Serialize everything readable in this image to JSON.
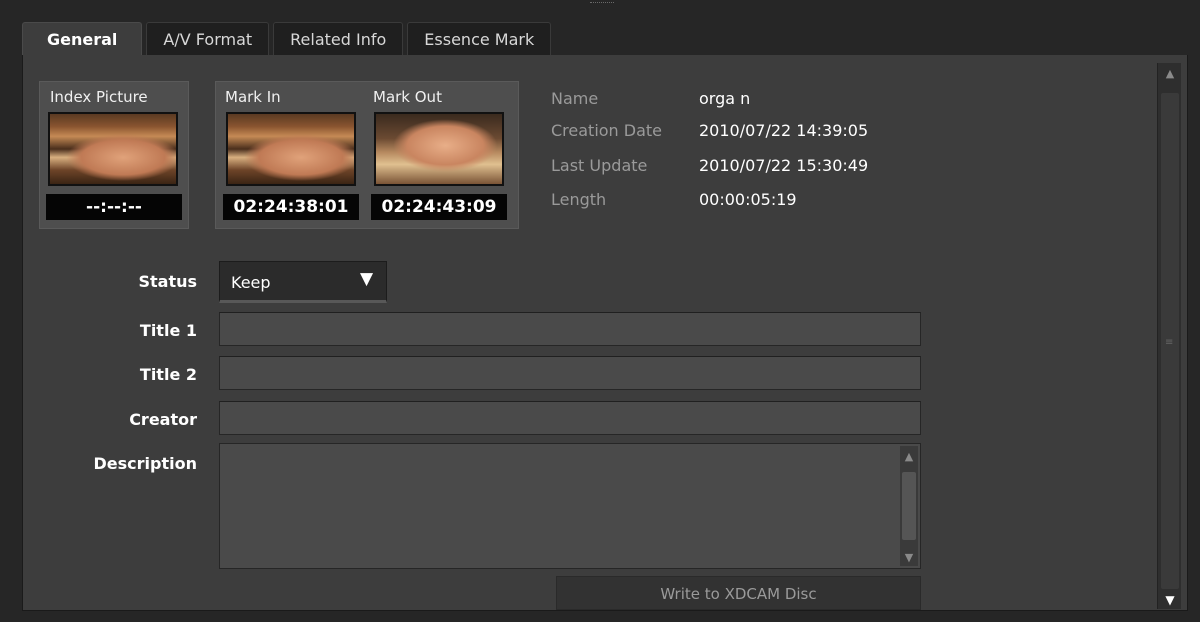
{
  "tabs": [
    {
      "label": "General",
      "active": true
    },
    {
      "label": "A/V Format",
      "active": false
    },
    {
      "label": "Related Info",
      "active": false
    },
    {
      "label": "Essence Mark",
      "active": false
    }
  ],
  "thumbnails": {
    "index_picture": {
      "label": "Index Picture",
      "timecode": "--:--:--"
    },
    "mark_in": {
      "label": "Mark In",
      "timecode": "02:24:38:01"
    },
    "mark_out": {
      "label": "Mark Out",
      "timecode": "02:24:43:09"
    }
  },
  "info": [
    {
      "label": "Name",
      "value": "orga n"
    },
    {
      "label": "Creation Date",
      "value": "2010/07/22 14:39:05"
    },
    {
      "label": "Last Update",
      "value": "2010/07/22 15:30:49"
    },
    {
      "label": "Length",
      "value": "00:00:05:19"
    }
  ],
  "form": {
    "status_label": "Status",
    "status_value": "Keep",
    "status_arrow": "▼",
    "title1_label": "Title 1",
    "title1_value": "",
    "title2_label": "Title 2",
    "title2_value": "",
    "creator_label": "Creator",
    "creator_value": "",
    "description_label": "Description",
    "description_value": ""
  },
  "write_button": "Write to XDCAM Disc",
  "icons": {
    "scroll_up": "▲",
    "scroll_down": "▼",
    "grip": "≡"
  },
  "colors": {
    "panel_bg": "#3d3d3d",
    "field_bg": "#4a4a4a",
    "timecode_bg": "#050505"
  }
}
